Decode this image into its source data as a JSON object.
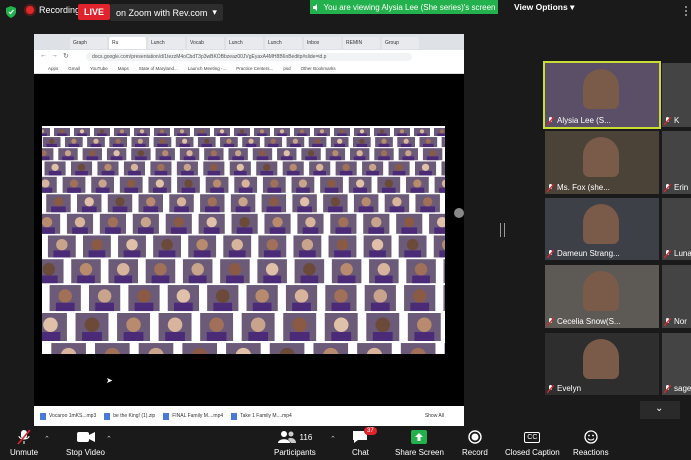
{
  "top": {
    "recording_label": "Recording",
    "live_label": "LIVE",
    "stream_label": "on Zoom with Rev.com",
    "viewing_banner": "You are viewing Alysia Lee (She series)'s screen",
    "view_options_label": "View Options"
  },
  "browser": {
    "tabs": [
      "Graph",
      "Ru",
      "Lunch",
      "Vocab",
      "Lunch",
      "Lunch",
      "Inbox",
      "REMIN",
      "Group"
    ],
    "address": "docs.google.com/presentation/d/1tezzM4oCbdT3p3wBKOBbzeaz00JVgEyaxA4MH8B6nBeditp#slide=id.p",
    "bookmarks": [
      "Apps",
      "Gmail",
      "YouTube",
      "Maps",
      "State of Maryland...",
      "Launch Meeting -...",
      "Practice Centers...",
      "psd",
      "Other Bookmarks"
    ]
  },
  "downloads": {
    "items": [
      "Vocaroo 1mKS...mp3",
      "be the King! (1).zip",
      "FINAL Family M....mp4",
      "Take 1 Family M....mp4"
    ],
    "show_all": "Show All"
  },
  "gallery": [
    {
      "name": "Alysia Lee (S...",
      "active": true
    },
    {
      "name": "Ms. Fox (she...",
      "active": false
    },
    {
      "name": "Dameun Strang...",
      "active": false
    },
    {
      "name": "Cecelia Snow(S...",
      "active": false
    },
    {
      "name": "Evelyn",
      "active": false
    }
  ],
  "gallery_right": [
    "K",
    "Erin",
    "Luna",
    "Nor",
    "sage"
  ],
  "toolbar": {
    "unmute": "Unmute",
    "stop_video": "Stop Video",
    "participants": "Participants",
    "participants_count": "116",
    "chat": "Chat",
    "chat_badge": "37",
    "share_screen": "Share Screen",
    "record": "Record",
    "closed_caption": "Closed Caption",
    "closed_caption_icon": "CC",
    "reactions": "Reactions"
  },
  "colors": {
    "live_red": "#e0232d",
    "banner_green": "#23b14d",
    "share_green": "#23b14d",
    "active_speaker": "#c9dc33"
  }
}
